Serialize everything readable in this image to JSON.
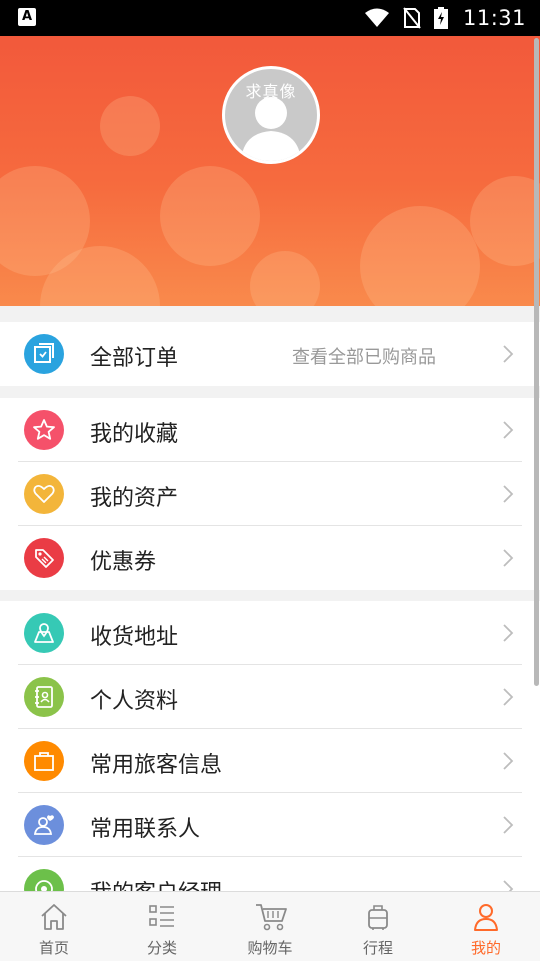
{
  "status_bar": {
    "left_icon": "A",
    "time": "11:31",
    "icons": [
      "wifi-icon",
      "no-sim-icon",
      "battery-charging-icon"
    ]
  },
  "profile": {
    "avatar_caption": "求真像"
  },
  "menu": {
    "orders": {
      "label": "全部订单",
      "hint": "查看全部已购商品",
      "icon": "orders-icon",
      "color": "#2aa3df"
    },
    "group2": [
      {
        "label": "我的收藏",
        "icon": "star-icon",
        "color": "#f5516a"
      },
      {
        "label": "我的资产",
        "icon": "heart-icon",
        "color": "#f3b53a"
      },
      {
        "label": "优惠券",
        "icon": "coupon-tag-icon",
        "color": "#ea3c45"
      }
    ],
    "group3": [
      {
        "label": "收货地址",
        "icon": "map-icon",
        "color": "#36c9b5"
      },
      {
        "label": "个人资料",
        "icon": "contact-book-icon",
        "color": "#8bc34a"
      },
      {
        "label": "常用旅客信息",
        "icon": "shopping-bag-icon",
        "color": "#ff8a00"
      },
      {
        "label": "常用联系人",
        "icon": "contact-person-icon",
        "color": "#6c8fdc"
      },
      {
        "label": "我的客户经理",
        "icon": "manager-icon",
        "color": "#6cc04a"
      }
    ]
  },
  "tabbar": {
    "tabs": [
      {
        "label": "首页",
        "icon": "home-icon"
      },
      {
        "label": "分类",
        "icon": "category-list-icon"
      },
      {
        "label": "购物车",
        "icon": "cart-icon"
      },
      {
        "label": "行程",
        "icon": "luggage-icon"
      },
      {
        "label": "我的",
        "icon": "profile-icon",
        "active": true
      }
    ],
    "active_color": "#ff6a2a"
  }
}
